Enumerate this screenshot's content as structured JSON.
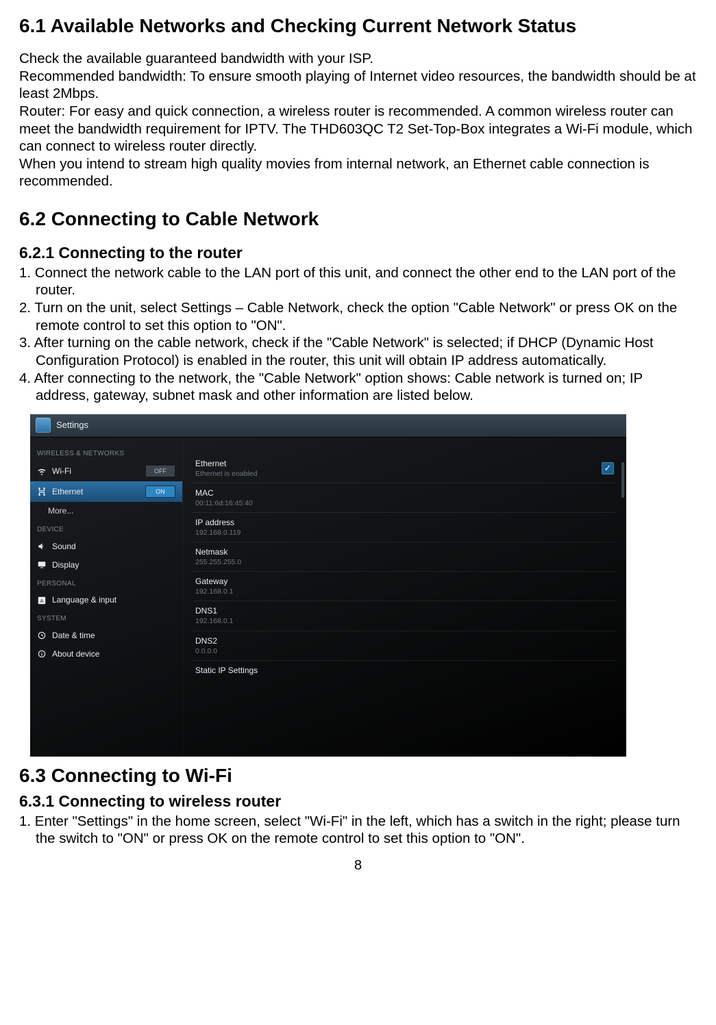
{
  "s61": {
    "heading": "6.1 Available Networks and Checking Current Network Status",
    "p1": "Check the available guaranteed bandwidth with your ISP.",
    "p2": "Recommended bandwidth: To ensure smooth playing of Internet video resources, the bandwidth should be at least 2Mbps.",
    "p3": "Router: For easy and quick connection, a wireless router is recommended. A common wireless router can meet the bandwidth requirement for IPTV.  The THD603QC T2 Set-Top-Box integrates a Wi-Fi module, which can connect to wireless router directly.",
    "p4": "When you intend to stream high quality movies from internal network, an Ethernet cable connection is recommended."
  },
  "s62": {
    "heading": "6.2 Connecting to Cable Network",
    "sub": "6.2.1 Connecting to the router",
    "steps": [
      "1. Connect the network cable to the LAN port of this unit, and connect the other end to the LAN port of the router.",
      "2. Turn on the unit, select Settings – Cable Network, check the option \"Cable Network\" or press OK on the remote control to set this option to \"ON\".",
      "3. After turning on the cable network, check if the \"Cable Network\" is selected; if DHCP (Dynamic Host Configuration Protocol) is enabled in the router, this unit will obtain IP address automatically.",
      "4. After connecting to the network, the \"Cable Network\" option shows: Cable network is turned on; IP address, gateway, subnet mask and other information are listed below."
    ]
  },
  "screenshot": {
    "title": "Settings",
    "cat_wireless": "WIRELESS & NETWORKS",
    "cat_device": "DEVICE",
    "cat_personal": "PERSONAL",
    "cat_system": "SYSTEM",
    "nav": {
      "wifi": "Wi-Fi",
      "wifi_state": "OFF",
      "ethernet": "Ethernet",
      "ethernet_state": "ON",
      "more": "More...",
      "sound": "Sound",
      "display": "Display",
      "lang": "Language & input",
      "datetime": "Date & time",
      "about": "About device"
    },
    "right": {
      "ethernet_label": "Ethernet",
      "ethernet_sub": "Ethernet is enabled",
      "mac_label": "MAC",
      "mac_val": "00:11:6d:16:45:40",
      "ip_label": "IP address",
      "ip_val": "192.168.0.119",
      "netmask_label": "Netmask",
      "netmask_val": "255.255.255.0",
      "gateway_label": "Gateway",
      "gateway_val": "192.168.0.1",
      "dns1_label": "DNS1",
      "dns1_val": "192.168.0.1",
      "dns2_label": "DNS2",
      "dns2_val": "0.0.0.0",
      "static_label": "Static IP Settings"
    }
  },
  "s63": {
    "heading": "6.3 Connecting to Wi-Fi",
    "sub": "6.3.1 Connecting to wireless router",
    "steps": [
      "1. Enter \"Settings\" in the home screen, select \"Wi-Fi\" in the left, which has a switch in the right; please turn the switch to \"ON\" or press OK on the remote control to set this option to \"ON\"."
    ]
  },
  "page_number": "8"
}
